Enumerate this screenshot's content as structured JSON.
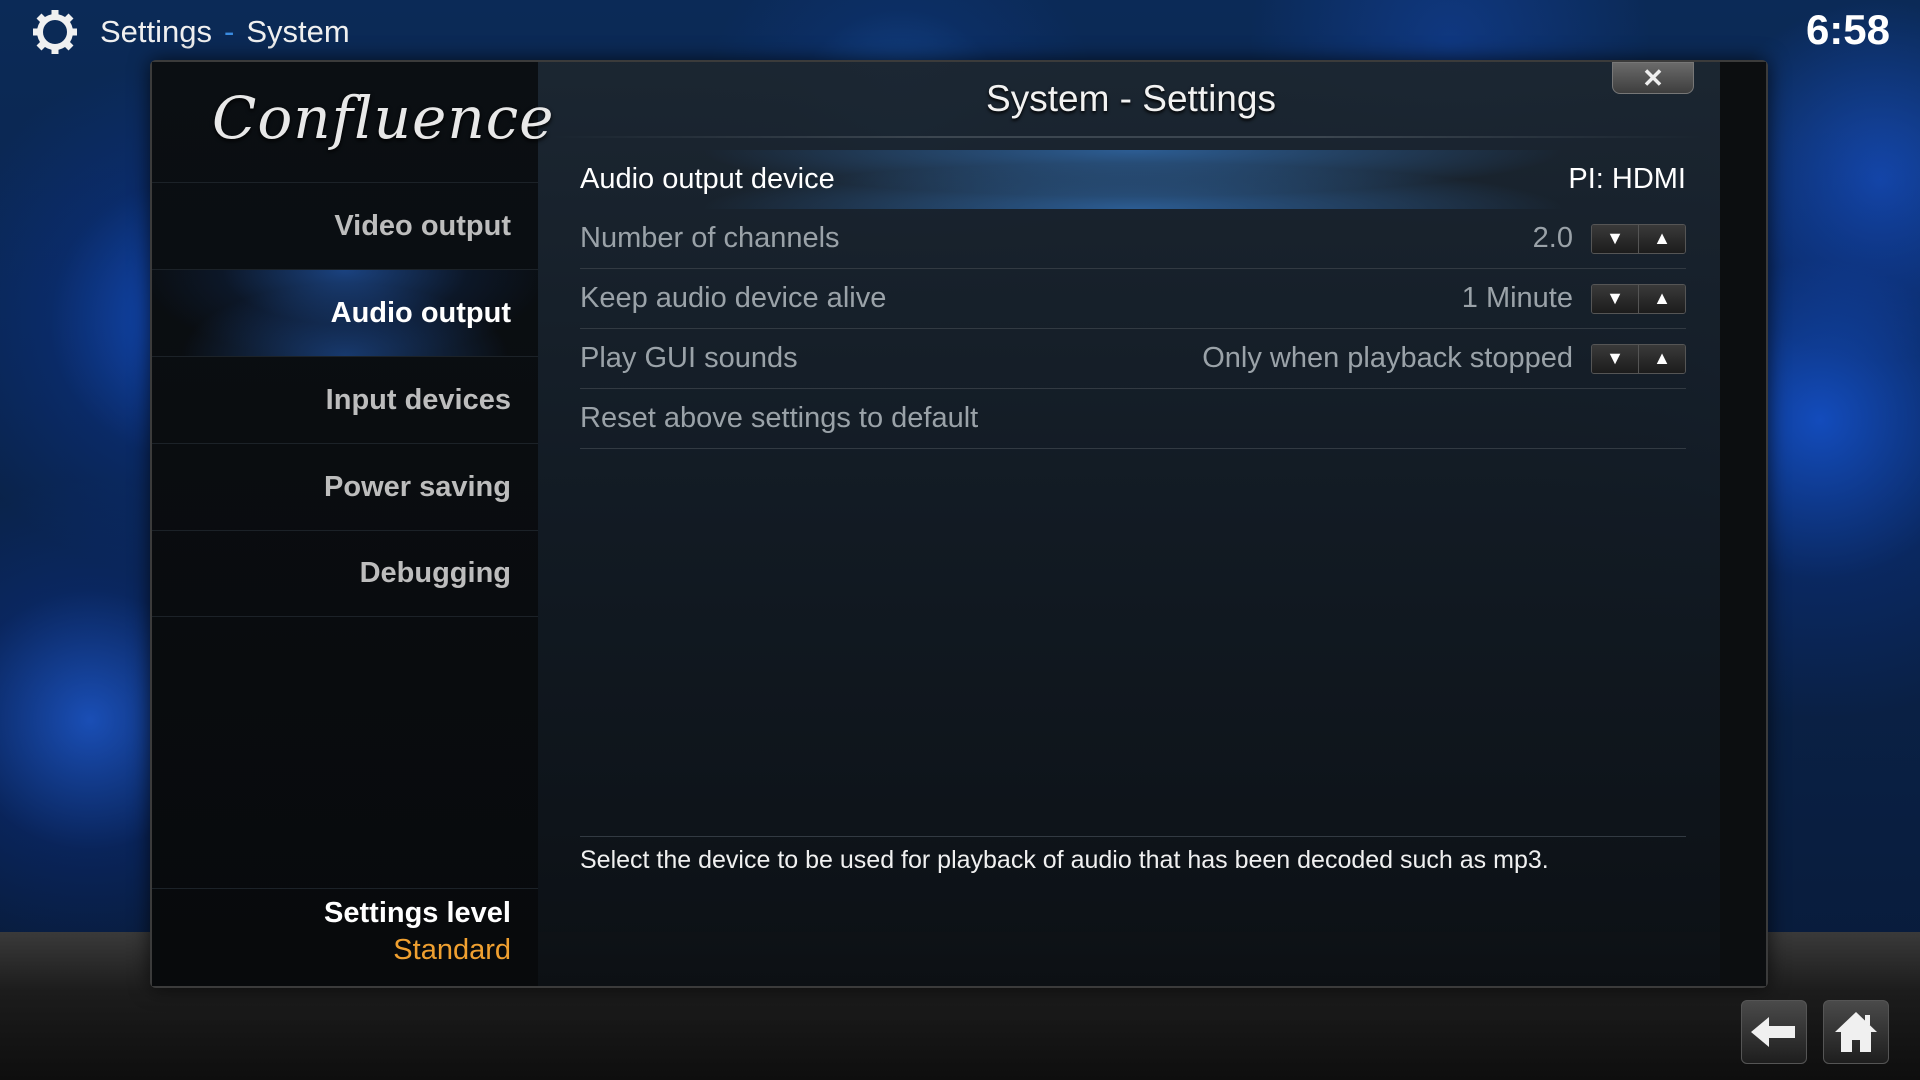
{
  "header": {
    "section": "Settings",
    "separator": "-",
    "subsection": "System",
    "clock": "6:58"
  },
  "dialog": {
    "logo": "Confluence",
    "title": "System - Settings",
    "close_label": "✕",
    "sidebar": {
      "items": [
        {
          "label": "Video output",
          "active": false
        },
        {
          "label": "Audio output",
          "active": true
        },
        {
          "label": "Input devices",
          "active": false
        },
        {
          "label": "Power saving",
          "active": false
        },
        {
          "label": "Debugging",
          "active": false
        }
      ],
      "settings_level_label": "Settings level",
      "settings_level_value": "Standard"
    },
    "rows": [
      {
        "label": "Audio output device",
        "value": "PI: HDMI",
        "focused": true
      },
      {
        "label": "Number of channels",
        "value": "2.0",
        "spin": true
      },
      {
        "label": "Keep audio device alive",
        "value": "1 Minute",
        "spin": true
      },
      {
        "label": "Play GUI sounds",
        "value": "Only when playback stopped",
        "spin": true
      },
      {
        "label": "Reset above settings to default",
        "value": ""
      }
    ],
    "description": "Select the device to be used for playback of audio that has been decoded such as mp3."
  },
  "icons": {
    "gear": "gear-icon",
    "down": "▼",
    "up": "▲",
    "back": "back-arrow-icon",
    "home": "home-icon"
  },
  "colors": {
    "accent": "#3a8bdf",
    "level": "#f0a030"
  }
}
